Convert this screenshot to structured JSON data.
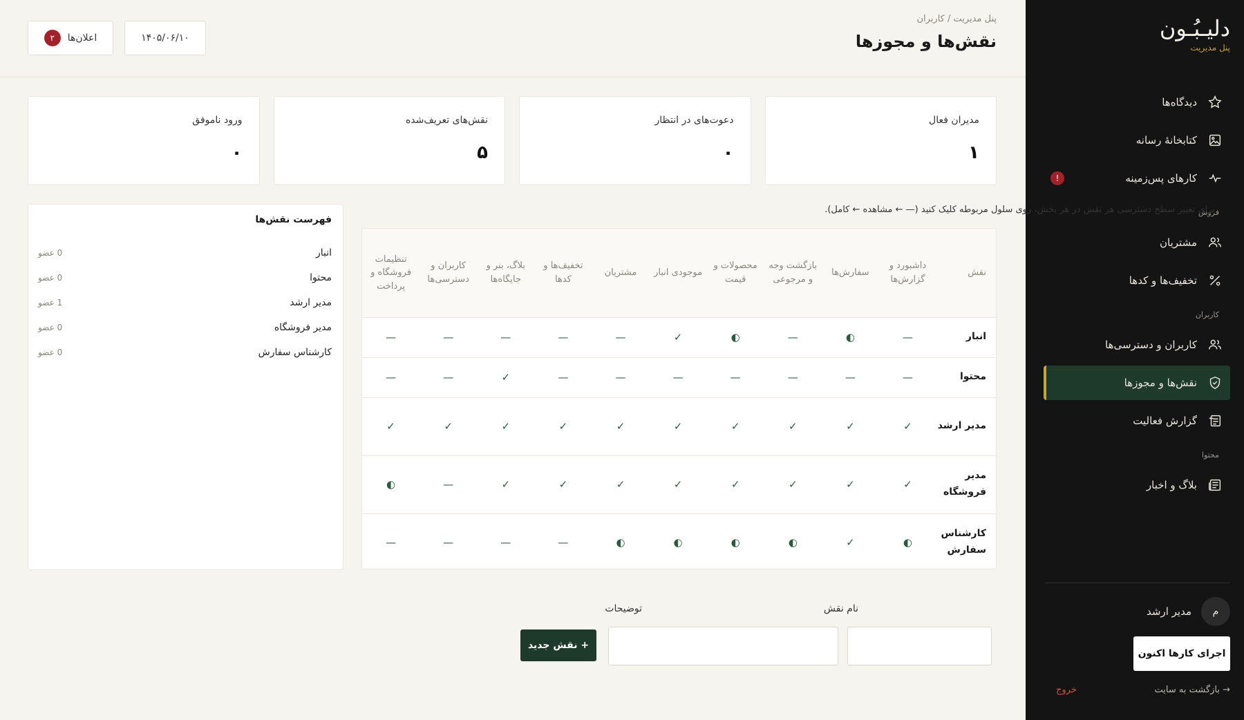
{
  "brand": {
    "logo": "دلیـبُـون",
    "subtitle": "پنل مدیریت"
  },
  "sidebar": {
    "items_top": [
      {
        "label": "دیدگاه‌ها",
        "icon": "star-icon"
      },
      {
        "label": "کتابخانهٔ رسانه",
        "icon": "image-icon"
      },
      {
        "label": "کارهای پس‌زمینه",
        "icon": "activity-icon",
        "badge": "!"
      }
    ],
    "section_sales": "فروش",
    "items_sales": [
      {
        "label": "مشتریان",
        "icon": "users-icon"
      },
      {
        "label": "تخفیف‌ها و کدها",
        "icon": "percent-icon"
      }
    ],
    "section_users": "کاربران",
    "items_users": [
      {
        "label": "کاربران و دسترسی‌ها",
        "icon": "users-icon"
      },
      {
        "label": "نقش‌ها و مجوزها",
        "icon": "shield-icon",
        "active": true
      },
      {
        "label": "گزارش فعالیت",
        "icon": "log-icon"
      }
    ],
    "section_content": "محتوا",
    "items_content": [
      {
        "label": "بلاگ و اخبار",
        "icon": "news-icon"
      }
    ],
    "user": {
      "avatar": "م",
      "name": "مدیر ارشد"
    },
    "run_button": "اجرای کارها اکنون",
    "back_link": "→ بازگشت به سایت",
    "logout": "خروج"
  },
  "header": {
    "breadcrumb": "پنل مدیریت / کاربران",
    "title": "نقش‌ها و مجوزها",
    "date": "۱۴۰۵/۰۶/۱۰",
    "notifications_label": "اعلان‌ها",
    "notifications_count": "۲"
  },
  "stats": [
    {
      "label": "مدیران فعال",
      "value": "۱"
    },
    {
      "label": "دعوت‌های در انتظار",
      "value": "۰"
    },
    {
      "label": "نقش‌های تعریف‌شده",
      "value": "۵"
    },
    {
      "label": "ورود ناموفق",
      "value": "۰"
    }
  ],
  "roles_panel": {
    "title": "فهرست نقش‌ها",
    "roles": [
      {
        "name": "انبار",
        "members": "0 عضو"
      },
      {
        "name": "محتوا",
        "members": "0 عضو"
      },
      {
        "name": "مدیر ارشد",
        "members": "1 عضو"
      },
      {
        "name": "مدیر فروشگاه",
        "members": "0 عضو"
      },
      {
        "name": "کارشناس سفارش",
        "members": "0 عضو"
      }
    ]
  },
  "matrix": {
    "hint": "برای تغییر سطح دسترسی هر نقش در هر بخش، روی سلول مربوطه کلیک کنید (— ← مشاهده ← کامل).",
    "role_header": "نقش",
    "columns": [
      "داشبورد و گزارش‌ها",
      "سفارش‌ها",
      "بازگشت وجه و مرجوعی",
      "محصولات و قیمت",
      "موجودی انبار",
      "مشتریان",
      "تخفیف‌ها و کدها",
      "بلاگ، بنر و جایگاه‌ها",
      "کاربران و دسترسی‌ها",
      "تنظیمات فروشگاه و پرداخت"
    ],
    "symbols": {
      "none": "—",
      "view": "◐",
      "full": "✓"
    },
    "rows": [
      {
        "role": "انبار",
        "levels": [
          "none",
          "view",
          "none",
          "view",
          "full",
          "none",
          "none",
          "none",
          "none",
          "none"
        ]
      },
      {
        "role": "محتوا",
        "levels": [
          "none",
          "none",
          "none",
          "none",
          "none",
          "none",
          "none",
          "full",
          "none",
          "none"
        ]
      },
      {
        "role": "مدیر ارشد",
        "levels": [
          "full",
          "full",
          "full",
          "full",
          "full",
          "full",
          "full",
          "full",
          "full",
          "full"
        ]
      },
      {
        "role": "مدیر فروشگاه",
        "levels": [
          "full",
          "full",
          "full",
          "full",
          "full",
          "full",
          "full",
          "full",
          "none",
          "view"
        ]
      },
      {
        "role": "کارشناس سفارش",
        "levels": [
          "view",
          "full",
          "view",
          "view",
          "view",
          "view",
          "none",
          "none",
          "none",
          "none"
        ]
      }
    ]
  },
  "form": {
    "name_label": "نام نقش",
    "name_value": "",
    "desc_label": "توضیحات",
    "desc_value": "",
    "submit": "+ نقش جدید"
  },
  "colors": {
    "accent": "#c9a23c",
    "primary": "#1e3a2b",
    "sidebar_bg": "#141414",
    "danger": "#a3222a"
  }
}
